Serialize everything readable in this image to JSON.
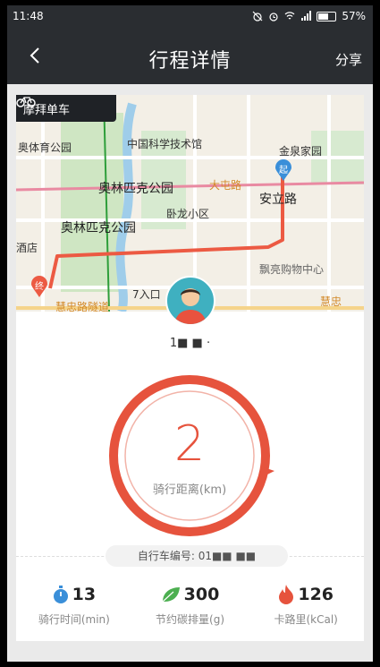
{
  "statusbar": {
    "time": "11:48",
    "battery": "57%"
  },
  "header": {
    "title": "行程详情",
    "share_label": "分享"
  },
  "map": {
    "brand": "摩拜单车",
    "labels": {
      "sports_park": "奥体育公园",
      "cas_museum": "中国科学技术馆",
      "jinquan": "金泉家园",
      "olympic_park_1": "奥林匹克公园",
      "datun_road": "大屯路",
      "anli_road": "安立路",
      "olympic_park_2": "奥林匹克公园",
      "wolong": "卧龙小区",
      "hotel": "酒店",
      "piaoliang": "飘亮购物中心",
      "exit7": "7入口",
      "huizhong_road": "慧忠路隧道",
      "huizhong": "慧忠"
    },
    "start_marker": "起",
    "end_marker": "终"
  },
  "user": {
    "name": "1■ ■ ·"
  },
  "distance": {
    "value": "2",
    "label": "骑行距离(km)"
  },
  "bike": {
    "number": "自行车编号: 01■■ ■■"
  },
  "stats": [
    {
      "icon": "stopwatch-icon",
      "value": "13",
      "label": "骑行时间(min)",
      "color": "#3a8fd9"
    },
    {
      "icon": "leaf-icon",
      "value": "300",
      "label": "节约碳排量(g)",
      "color": "#4caf50"
    },
    {
      "icon": "flame-icon",
      "value": "126",
      "label": "卡路里(kCal)",
      "color": "#e6533d"
    }
  ],
  "colors": {
    "accent": "#e6533d",
    "dark": "#2a2d31"
  }
}
